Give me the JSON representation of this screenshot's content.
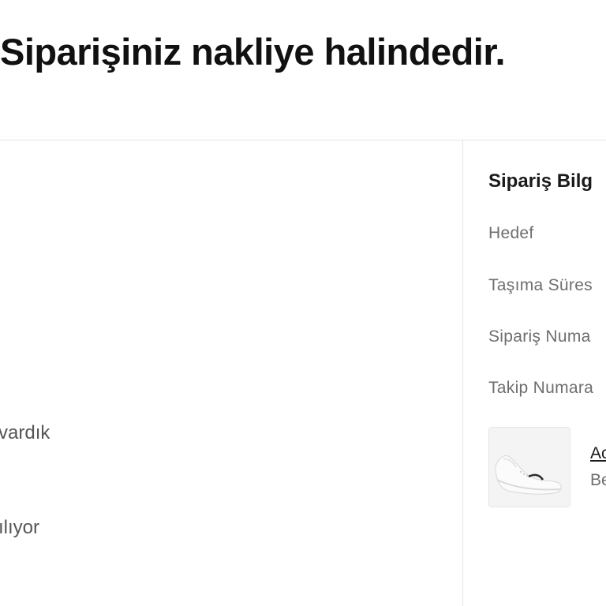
{
  "header": {
    "title": "Siparişiniz nakliye halindedir."
  },
  "timeline": {
    "steps": [
      {
        "label": "ına vardık"
      },
      {
        "label": "ktarılıyor"
      }
    ]
  },
  "order_info": {
    "title": "Sipariş Bilg",
    "fields": [
      {
        "label": "Hedef"
      },
      {
        "label": "Taşıma Süres"
      },
      {
        "label": "Sipariş Numa"
      },
      {
        "label": "Takip Numara"
      }
    ]
  },
  "product": {
    "name": "Ac",
    "variant": "Be",
    "image_icon": "sneaker-image"
  }
}
